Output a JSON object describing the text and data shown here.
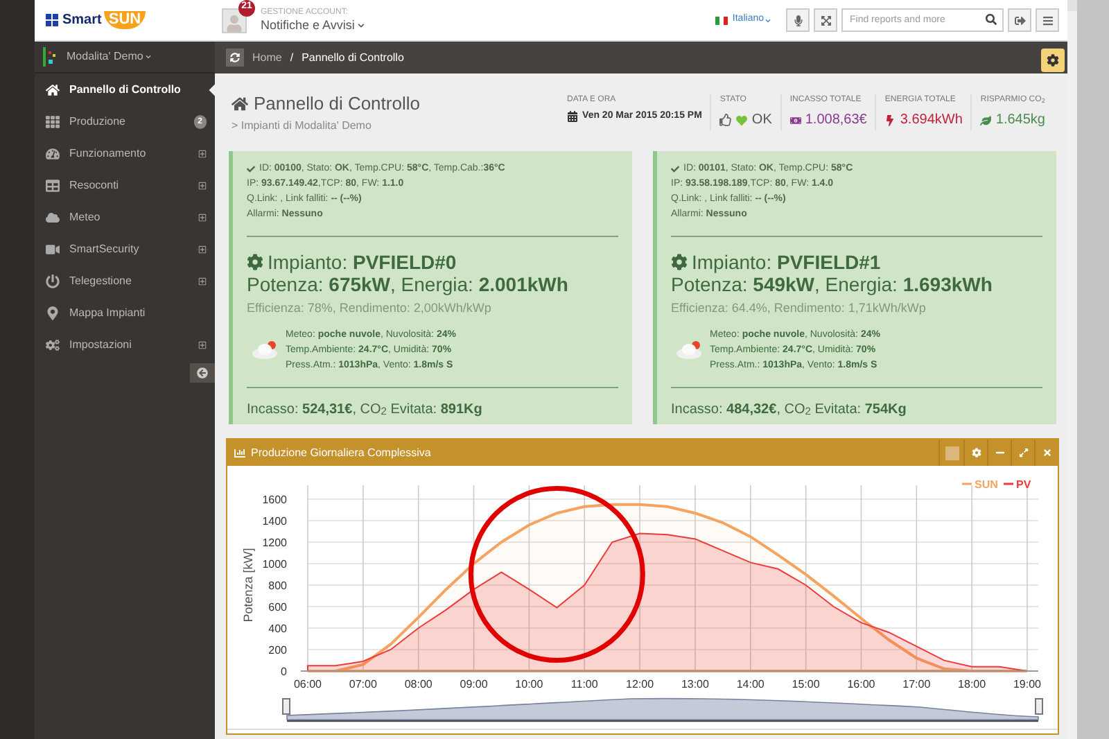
{
  "header": {
    "logo": {
      "part1": "Smart",
      "part2": "SUN"
    },
    "notifications": {
      "count": "21",
      "caption": "GESTIONE ACCOUNT:",
      "title": "Notifiche e Avvisi"
    },
    "language": "Italiano",
    "search": {
      "placeholder": "Find reports and more"
    }
  },
  "sidebar": {
    "mode": "Modalita' Demo",
    "items": [
      {
        "kind": "home",
        "label": "Pannello di Controllo",
        "selected": true,
        "expandable": false
      },
      {
        "kind": "grid",
        "label": "Produzione",
        "selected": false,
        "expandable": false,
        "badge": "2"
      },
      {
        "kind": "gauge",
        "label": "Funzionamento",
        "selected": false,
        "expandable": true
      },
      {
        "kind": "table",
        "label": "Resoconti",
        "selected": false,
        "expandable": true
      },
      {
        "kind": "cloud",
        "label": "Meteo",
        "selected": false,
        "expandable": true
      },
      {
        "kind": "video",
        "label": "SmartSecurity",
        "selected": false,
        "expandable": true
      },
      {
        "kind": "power",
        "label": "Telegestione",
        "selected": false,
        "expandable": true
      },
      {
        "kind": "pin",
        "label": "Mappa Impianti",
        "selected": false,
        "expandable": false
      },
      {
        "kind": "cogs",
        "label": "Impostazioni",
        "selected": false,
        "expandable": true
      }
    ]
  },
  "breadcrumb": [
    "Home",
    "/",
    "Pannello di Controllo"
  ],
  "page": {
    "title": "Pannello di Controllo",
    "subtitle": "> Impianti di Modalita' Demo"
  },
  "stats": [
    {
      "kind": "date",
      "label": "DATA E ORA",
      "value": "Ven 20 Mar 2015 20:15 PM",
      "color": "#333333"
    },
    {
      "kind": "status",
      "label": "STATO",
      "value": "OK",
      "color": "#555555"
    },
    {
      "kind": "money",
      "label": "INCASSO TOTALE",
      "value": "1.008,63€",
      "color": "#8b3a8f"
    },
    {
      "kind": "energy",
      "label": "ENERGIA TOTALE",
      "value": "3.694kWh",
      "color": "#c0243c"
    },
    {
      "kind": "co2",
      "label": "RISPARMIO CO$_{2}$",
      "value": "1.645kg",
      "color": "#4d8a4d"
    }
  ],
  "plants": [
    {
      "info": [
        "ID: **00100**, Stato: **OK**, Temp.CPU: **58°C**, Temp.Cab.:**36°C**",
        "IP: **93.67.149.42**,TCP: **80**, FW: **1.1.0**",
        "Q.Link: , Link falliti: **-- (--%)**",
        "Allarmi: **Nessuno**"
      ],
      "title": "Impianto: **PVFIELD#0**",
      "power": "Potenza: **675kW**, Energia: **2.001kWh**",
      "efficiency": "Efficienza: 78%, Rendimento: 2,00kWh/kWp",
      "weather": [
        "Meteo: **poche nuvole**, Nuvolosità: **24%**",
        "Temp.Ambiente: **24.7°C**, Umidità: **70%**",
        "Press.Atm.: **1013hPa**, Vento: **1.8m/s S**"
      ],
      "totals": "Incasso: **524,31€**, CO$_{2}$ Evitata: **891Kg**"
    },
    {
      "info": [
        "ID: **00101**, Stato: **OK**, Temp.CPU: **58°C**",
        "IP: **93.58.198.189**,TCP: **80**, FW: **1.4.0**",
        "Q.Link: , Link falliti: **-- (--%)**",
        "Allarmi: **Nessuno**"
      ],
      "title": "Impianto: **PVFIELD#1**",
      "power": "Potenza: **549kW**, Energia: **1.693kWh**",
      "efficiency": "Efficienza: 64.4%, Rendimento: 1,71kWh/kWp",
      "weather": [
        "Meteo: **poche nuvole**, Nuvolosità: **24%**",
        "Temp.Ambiente: **24.7°C**, Umidità: **70%**",
        "Press.Atm.: **1013hPa**, Vento: **1.8m/s S**"
      ],
      "totals": "Incasso: **484,32€**, CO$_{2}$ Evitata: **754Kg**"
    }
  ],
  "chart_panel": {
    "title": "Produzione Giornaliera Complessiva",
    "highlight": {
      "kind": "circle"
    },
    "chart_data": {
      "type": "area",
      "grid": true,
      "legend": "top-right",
      "ylabel": "Potenza [kW]",
      "x": [
        6,
        6.5,
        7,
        7.5,
        8,
        8.5,
        9,
        9.5,
        10,
        10.5,
        11,
        11.5,
        12,
        12.5,
        13,
        13.5,
        14,
        14.5,
        15,
        15.5,
        16,
        16.5,
        17,
        17.5,
        18,
        18.5,
        19
      ],
      "series": [
        {
          "name": "SUN",
          "color": "#f4a460",
          "values": [
            0,
            0,
            60,
            250,
            500,
            760,
            1000,
            1200,
            1360,
            1470,
            1530,
            1550,
            1550,
            1530,
            1470,
            1380,
            1250,
            1080,
            900,
            700,
            490,
            290,
            120,
            20,
            0,
            0,
            0
          ]
        },
        {
          "name": "PV",
          "color": "#ee3a3a",
          "values": [
            50,
            50,
            90,
            200,
            400,
            570,
            760,
            920,
            760,
            590,
            800,
            1200,
            1280,
            1270,
            1230,
            1120,
            1010,
            950,
            800,
            600,
            450,
            360,
            230,
            100,
            40,
            40,
            0
          ]
        }
      ],
      "xlim": [
        6,
        19
      ],
      "ylim": [
        0,
        1600
      ],
      "xticks": [
        {
          "value": 6,
          "label": "06:00"
        },
        {
          "value": 7,
          "label": "07:00"
        },
        {
          "value": 8,
          "label": "08:00"
        },
        {
          "value": 9,
          "label": "09:00"
        },
        {
          "value": 10,
          "label": "10:00"
        },
        {
          "value": 11,
          "label": "11:00"
        },
        {
          "value": 12,
          "label": "12:00"
        },
        {
          "value": 13,
          "label": "13:00"
        },
        {
          "value": 14,
          "label": "14:00"
        },
        {
          "value": 15,
          "label": "15:00"
        },
        {
          "value": 16,
          "label": "16:00"
        },
        {
          "value": 17,
          "label": "17:00"
        },
        {
          "value": 18,
          "label": "18:00"
        },
        {
          "value": 19,
          "label": "19:00"
        }
      ],
      "yticks": [
        0,
        200,
        400,
        600,
        800,
        1000,
        1200,
        1400,
        1600
      ]
    }
  }
}
